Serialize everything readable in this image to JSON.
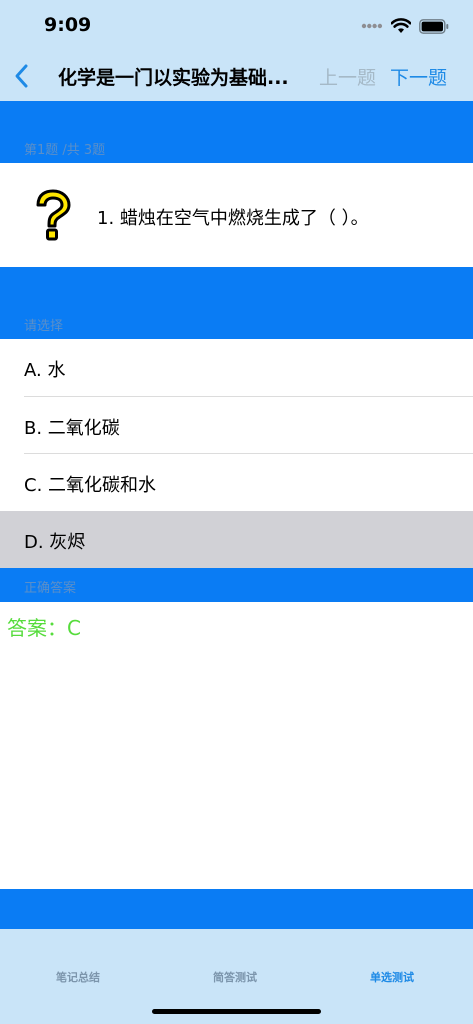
{
  "status": {
    "time": "9:09"
  },
  "nav": {
    "title": "化学是一门以实验为基础...",
    "prev": "上一题",
    "next": "下一题"
  },
  "section_labels": {
    "progress": "第1题 /共 3题",
    "choose": "请选择",
    "correct": "正确答案"
  },
  "question": {
    "text": "1.  蜡烛在空气中燃烧生成了（ ）。"
  },
  "options": [
    {
      "text": "A.  水"
    },
    {
      "text": "B.  二氧化碳"
    },
    {
      "text": "C.  二氧化碳和水"
    },
    {
      "text": "D.  灰烬"
    }
  ],
  "answer": "答案：C",
  "tabs": [
    {
      "label": "笔记总结"
    },
    {
      "label": "简答测试"
    },
    {
      "label": "单选测试"
    }
  ],
  "colors": {
    "bar": "#c9e4f8",
    "band": "#0a7cf4",
    "accent": "#1e8ae6",
    "answer": "#56dc3c"
  }
}
